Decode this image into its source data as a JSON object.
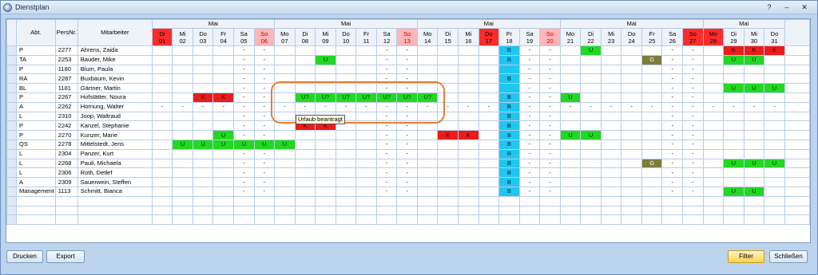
{
  "window": {
    "title": "Dienstplan",
    "help_glyph": "?",
    "min_glyph": "–",
    "close_glyph": "✕"
  },
  "headers": {
    "abt": "Abt.",
    "persnr": "PersNr.",
    "mitarbeiter": "Mitarbeiter"
  },
  "months": [
    {
      "label": "Mai",
      "span": 6
    },
    {
      "label": "Mai",
      "span": 7
    },
    {
      "label": "Mai",
      "span": 7
    },
    {
      "label": "Mai",
      "span": 7
    },
    {
      "label": "Mai",
      "span": 4
    }
  ],
  "days": [
    {
      "wd": "Di",
      "d": "01",
      "t": "hol"
    },
    {
      "wd": "Mi",
      "d": "02",
      "t": ""
    },
    {
      "wd": "Do",
      "d": "03",
      "t": ""
    },
    {
      "wd": "Fr",
      "d": "04",
      "t": ""
    },
    {
      "wd": "Sa",
      "d": "05",
      "t": ""
    },
    {
      "wd": "So",
      "d": "06",
      "t": "wk"
    },
    {
      "wd": "Mo",
      "d": "07",
      "t": ""
    },
    {
      "wd": "Di",
      "d": "08",
      "t": ""
    },
    {
      "wd": "Mi",
      "d": "09",
      "t": ""
    },
    {
      "wd": "Do",
      "d": "10",
      "t": ""
    },
    {
      "wd": "Fr",
      "d": "11",
      "t": ""
    },
    {
      "wd": "Sa",
      "d": "12",
      "t": ""
    },
    {
      "wd": "So",
      "d": "13",
      "t": "wk"
    },
    {
      "wd": "Mo",
      "d": "14",
      "t": ""
    },
    {
      "wd": "Di",
      "d": "15",
      "t": ""
    },
    {
      "wd": "Mi",
      "d": "16",
      "t": ""
    },
    {
      "wd": "Do",
      "d": "17",
      "t": "hol"
    },
    {
      "wd": "Fr",
      "d": "18",
      "t": ""
    },
    {
      "wd": "Sa",
      "d": "19",
      "t": ""
    },
    {
      "wd": "So",
      "d": "20",
      "t": "wk"
    },
    {
      "wd": "Mo",
      "d": "21",
      "t": ""
    },
    {
      "wd": "Di",
      "d": "22",
      "t": ""
    },
    {
      "wd": "Mi",
      "d": "23",
      "t": ""
    },
    {
      "wd": "Do",
      "d": "24",
      "t": ""
    },
    {
      "wd": "Fr",
      "d": "25",
      "t": ""
    },
    {
      "wd": "Sa",
      "d": "26",
      "t": ""
    },
    {
      "wd": "So",
      "d": "27",
      "t": "hol"
    },
    {
      "wd": "Mo",
      "d": "28",
      "t": "hol"
    },
    {
      "wd": "Di",
      "d": "29",
      "t": ""
    },
    {
      "wd": "Mi",
      "d": "30",
      "t": ""
    },
    {
      "wd": "Do",
      "d": "31",
      "t": ""
    }
  ],
  "rows": [
    {
      "abt": "P",
      "nr": "2277",
      "name": "Ahrens, Zaida",
      "cells": {
        "5": "-",
        "6": "-",
        "12": "-",
        "13": "-",
        "18": "B",
        "19": "-",
        "20": "-",
        "22": "U",
        "26": "-",
        "27": "-",
        "29": "K",
        "30": "K",
        "31": "K"
      }
    },
    {
      "abt": "TA",
      "nr": "2253",
      "name": "Bauder, Mike",
      "cells": {
        "5": "-",
        "6": "-",
        "9": "U",
        "12": "-",
        "13": "-",
        "18": "B",
        "19": "-",
        "20": "-",
        "25": "G",
        "26": "-",
        "27": "-",
        "29": "U",
        "30": "U"
      }
    },
    {
      "abt": "P",
      "nr": "1180",
      "name": "Blum, Paula",
      "cells": {
        "5": "-",
        "6": "-",
        "12": "-",
        "13": "-",
        "19": "-",
        "20": "-",
        "26": "-",
        "27": "-"
      }
    },
    {
      "abt": "RA",
      "nr": "2287",
      "name": "Buxbaum, Kevin",
      "cells": {
        "5": "-",
        "6": "-",
        "12": "-",
        "13": "-",
        "18": "B",
        "19": "-",
        "20": "-",
        "26": "-",
        "27": "-"
      }
    },
    {
      "abt": "BL",
      "nr": "1181",
      "name": "Gärtner, Martin",
      "cells": {
        "5": "-",
        "6": "-",
        "12": "-",
        "13": "-",
        "19": "-",
        "20": "-",
        "26": "-",
        "27": "-",
        "29": "U",
        "30": "U",
        "31": "U"
      }
    },
    {
      "abt": "P",
      "nr": "2267",
      "name": "Hofstätter, Noura",
      "cells": {
        "3": "K",
        "4": "K",
        "5": "-",
        "6": "-",
        "8": "U?",
        "9": "U?",
        "10": "U?",
        "11": "U?",
        "12": "U?",
        "13": "U?",
        "14": "U?",
        "18": "B",
        "19": "-",
        "20": "-",
        "21": "U",
        "26": "-",
        "27": "-"
      }
    },
    {
      "abt": "A",
      "nr": "2262",
      "name": "Hornung, Walter",
      "cells": {
        "1": "-",
        "2": "-",
        "3": "-",
        "4": "-",
        "5": "-",
        "6": "-",
        "7": "-",
        "8": "-",
        "9": "-",
        "10": "-",
        "11": "-",
        "12": "-",
        "13": "-",
        "14": "-",
        "15": "-",
        "16": "-",
        "17": "-",
        "18": "B",
        "19": "-",
        "20": "-",
        "21": "-",
        "22": "-",
        "23": "-",
        "24": "-",
        "25": "-",
        "26": "-",
        "27": "-",
        "28": "-",
        "29": "-",
        "30": "-",
        "31": "-"
      }
    },
    {
      "abt": "L",
      "nr": "2310",
      "name": "Joop, Waltraud",
      "cells": {
        "5": "-",
        "6": "-",
        "12": "-",
        "13": "-",
        "18": "B",
        "19": "-",
        "20": "-",
        "26": "-",
        "27": "-"
      }
    },
    {
      "abt": "P",
      "nr": "2242",
      "name": "Kanzel, Stephanie",
      "cells": {
        "5": "-",
        "6": "-",
        "8": "K",
        "9": "K",
        "12": "-",
        "13": "-",
        "18": "B",
        "19": "-",
        "20": "-",
        "26": "-",
        "27": "-"
      }
    },
    {
      "abt": "P",
      "nr": "2270",
      "name": "Kunzer, Marie",
      "cells": {
        "4": "U",
        "5": "-",
        "6": "-",
        "12": "-",
        "13": "-",
        "15": "K",
        "16": "K",
        "18": "B",
        "19": "-",
        "20": "-",
        "21": "U",
        "22": "U",
        "26": "-",
        "27": "-"
      }
    },
    {
      "abt": "QS",
      "nr": "2278",
      "name": "Mittelstedt, Jens",
      "cells": {
        "2": "U",
        "3": "U",
        "4": "U",
        "5": "U",
        "6": "U",
        "7": "U",
        "12": "-",
        "13": "-",
        "18": "B",
        "19": "-",
        "20": "-",
        "26": "-",
        "27": "-"
      }
    },
    {
      "abt": "L",
      "nr": "2304",
      "name": "Panzer, Kurt",
      "cells": {
        "5": "-",
        "6": "-",
        "12": "-",
        "13": "-",
        "18": "B",
        "19": "-",
        "20": "-",
        "26": "-",
        "27": "-"
      }
    },
    {
      "abt": "L",
      "nr": "2268",
      "name": "Pauli, Michaela",
      "cells": {
        "5": "-",
        "6": "-",
        "12": "-",
        "13": "-",
        "18": "B",
        "19": "-",
        "20": "-",
        "25": "G",
        "26": "-",
        "27": "-",
        "29": "U",
        "30": "U",
        "31": "U"
      }
    },
    {
      "abt": "L",
      "nr": "2306",
      "name": "Roth, Detlef",
      "cells": {
        "5": "-",
        "6": "-",
        "12": "-",
        "13": "-",
        "18": "B",
        "19": "-",
        "20": "-",
        "26": "-",
        "27": "-"
      }
    },
    {
      "abt": "A",
      "nr": "2309",
      "name": "Sauerwein, Steffen",
      "cells": {
        "5": "-",
        "6": "-",
        "12": "-",
        "13": "-",
        "18": "B",
        "19": "-",
        "20": "-",
        "26": "-",
        "27": "-"
      }
    },
    {
      "abt": "Management",
      "nr": "1113",
      "name": "Schmitt, Bianca",
      "cells": {
        "5": "-",
        "6": "-",
        "12": "-",
        "13": "-",
        "18": "B",
        "19": "-",
        "20": "-",
        "26": "-",
        "27": "-",
        "29": "U",
        "30": "U"
      }
    }
  ],
  "empty_rows": 3,
  "tooltip": "Urlaub beantragt",
  "buttons": {
    "drucken": "Drucken",
    "export": "Export",
    "filter": "Filter",
    "schliessen": "Schließen"
  },
  "colors": {
    "urlaub": "#22d822",
    "krank": "#ea1c1c",
    "berufsschule": "#1fc6f0",
    "g_code": "#7d7d3a",
    "feiertag": "#ff2b2b",
    "highlight": "#ec7b2e"
  }
}
